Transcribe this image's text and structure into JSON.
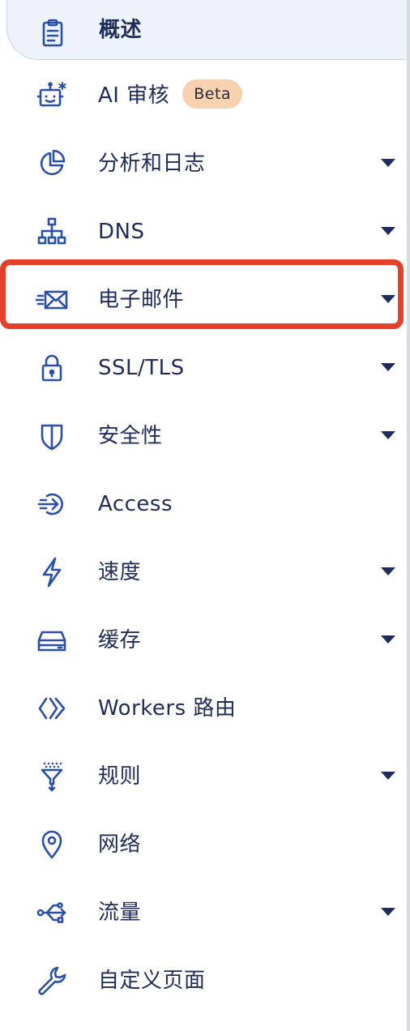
{
  "sidebar": {
    "items": [
      {
        "label": "概述",
        "icon": "clipboard-icon",
        "has_caret": false,
        "active": true
      },
      {
        "label": "AI 审核",
        "icon": "robot-icon",
        "has_caret": false,
        "badge": "Beta"
      },
      {
        "label": "分析和日志",
        "icon": "pie-chart-icon",
        "has_caret": true
      },
      {
        "label": "DNS",
        "icon": "network-tree-icon",
        "has_caret": true
      },
      {
        "label": "电子邮件",
        "icon": "envelope-icon",
        "has_caret": true,
        "highlighted": true
      },
      {
        "label": "SSL/TLS",
        "icon": "lock-icon",
        "has_caret": true
      },
      {
        "label": "安全性",
        "icon": "shield-icon",
        "has_caret": true
      },
      {
        "label": "Access",
        "icon": "sign-in-icon",
        "has_caret": false
      },
      {
        "label": "速度",
        "icon": "lightning-icon",
        "has_caret": true
      },
      {
        "label": "缓存",
        "icon": "server-stack-icon",
        "has_caret": true
      },
      {
        "label": "Workers 路由",
        "icon": "code-brackets-icon",
        "has_caret": false
      },
      {
        "label": "规则",
        "icon": "funnel-icon",
        "has_caret": true
      },
      {
        "label": "网络",
        "icon": "location-pin-icon",
        "has_caret": false
      },
      {
        "label": "流量",
        "icon": "traffic-icon",
        "has_caret": true
      },
      {
        "label": "自定义页面",
        "icon": "wrench-icon",
        "has_caret": false
      }
    ]
  },
  "colors": {
    "text": "#1f2c59",
    "icon": "#2a4fa8",
    "active_bg": "#edf2fb",
    "badge_bg": "#f6d2b1",
    "highlight": "#e5402a"
  }
}
